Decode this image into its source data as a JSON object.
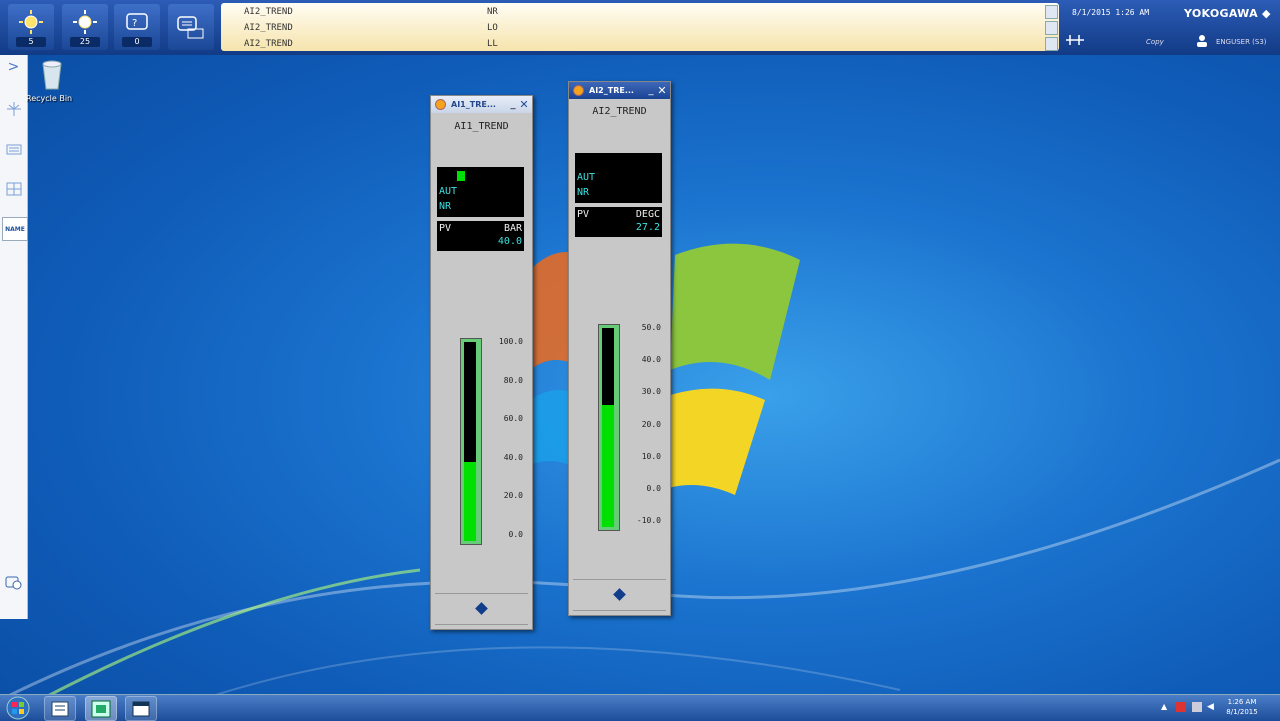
{
  "toolbar": {
    "buttons": [
      {
        "icon": "process-alarm-icon",
        "count": "5"
      },
      {
        "icon": "system-alarm-icon",
        "count": "25"
      },
      {
        "icon": "operator-guide-icon",
        "count": "0"
      },
      {
        "icon": "message-monitor-icon",
        "count": ""
      }
    ],
    "messages": [
      {
        "tag": "AI2_TREND",
        "state": "NR"
      },
      {
        "tag": "AI2_TREND",
        "state": "LO"
      },
      {
        "tag": "AI2_TREND",
        "state": "LL"
      }
    ],
    "datetime": "8/1/2015 1:26 AM",
    "brand": "YOKOGAWA",
    "copy_label": "Copy",
    "user_label": "ENGUSER (S3)"
  },
  "sidebar": {
    "name_label": "NAME"
  },
  "desktop": {
    "recycle_label": "Recycle Bin"
  },
  "faceplates": [
    {
      "window_title": "AI1_TRE...",
      "tag": "AI1_TREND",
      "mode": "AUT",
      "status": "NR",
      "pv_label": "PV",
      "unit": "BAR",
      "pv_value": "40.0",
      "scale": [
        "100.0",
        "80.0",
        "60.0",
        "40.0",
        "20.0",
        "0.0"
      ],
      "level_fraction": 0.4,
      "has_indicator": true
    },
    {
      "window_title": "AI2_TRE...",
      "tag": "AI2_TREND",
      "mode": "AUT",
      "status": "NR",
      "pv_label": "PV",
      "unit": "DEGC",
      "pv_value": "27.2",
      "scale": [
        "50.0",
        "40.0",
        "30.0",
        "20.0",
        "10.0",
        "0.0",
        "-10.0"
      ],
      "level_fraction": 0.62,
      "has_indicator": false
    }
  ],
  "taskbar": {
    "time": "1:26 AM",
    "date": "8/1/2015"
  },
  "colors": {
    "accent": "#1b4796",
    "message_bg": "#f6e4ac",
    "bar_fill": "#00e000",
    "pv_text": "#3ee0e0"
  }
}
